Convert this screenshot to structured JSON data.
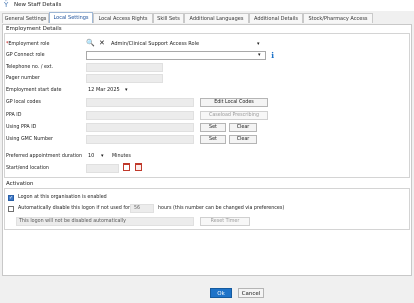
{
  "window": {
    "title": "New Staff Details"
  },
  "tabs": [
    {
      "label": "General Settings",
      "active": false
    },
    {
      "label": "Local Settings",
      "active": true
    },
    {
      "label": "Local Access Rights",
      "active": false
    },
    {
      "label": "Skill Sets",
      "active": false
    },
    {
      "label": "Additional Languages",
      "active": false
    },
    {
      "label": "Additional Details",
      "active": false
    },
    {
      "label": "Stock/Pharmacy Access",
      "active": false
    }
  ],
  "employment": {
    "group_title": "Employment Details",
    "role_label": "Employment role",
    "role_required_mark": "*",
    "role_value": "Admin/Clinical Support Access Role",
    "gp_connect_label": "GP Connect role",
    "gp_connect_value": "",
    "telephone_label": "Telephone no. / ext.",
    "pager_label": "Pager number",
    "start_date_label": "Employment start date",
    "start_date_value": "12 Mar 2025",
    "local_codes_label": "GP local codes",
    "edit_local_codes_button": "Edit Local Codes",
    "ppa_id_label": "PPA ID",
    "caseload_button": "Caseload Prescribing",
    "using_ppa_label": "Using PPA ID",
    "using_gmc_label": "Using GMC Number",
    "set_button": "Set",
    "clear_button": "Clear",
    "appt_duration_label": "Preferred appointment duration",
    "appt_duration_value": "10",
    "appt_duration_unit": "Minutes",
    "start_end_label": "Start/end location"
  },
  "activation": {
    "group_title": "Activation",
    "logon_enabled_label": "Logon at this organisation is enabled",
    "logon_enabled_checked": true,
    "auto_disable_label": "Automatically disable this logon if not used for",
    "auto_disable_checked": false,
    "auto_disable_value": "56",
    "auto_disable_suffix": "hours (this number can be changed via preferences)",
    "status_text": "This logon will not be disabled automatically",
    "reset_timer_button": "Reset Timer"
  },
  "footer": {
    "ok_button": "Ok",
    "cancel_button": "Cancel"
  },
  "colors": {
    "accent": "#1e73c8",
    "tab_active_text": "#1a4f9a",
    "required": "#c00000",
    "calendar_icon": "#c0392b",
    "info_icon": "#1e73c8"
  }
}
